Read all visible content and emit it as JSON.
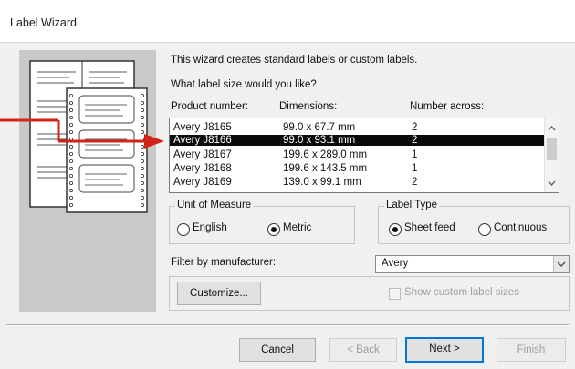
{
  "window": {
    "title": "Label Wizard"
  },
  "intro": {
    "line1": "This wizard creates standard labels or custom labels.",
    "line2": "What label size would you like?"
  },
  "table": {
    "headers": [
      "Product number:",
      "Dimensions:",
      "Number across:"
    ],
    "rows": [
      {
        "product": "Avery J8165",
        "dims": "99.0 x 67.7 mm",
        "across": "2"
      },
      {
        "product": "Avery J8166",
        "dims": "99.0 x 93.1 mm",
        "across": "2"
      },
      {
        "product": "Avery J8167",
        "dims": "199.6 x 289.0 mm",
        "across": "1"
      },
      {
        "product": "Avery J8168",
        "dims": "199.6 x 143.5 mm",
        "across": "1"
      },
      {
        "product": "Avery J8169",
        "dims": "139.0 x 99.1 mm",
        "across": "2"
      }
    ],
    "selected_product": "Avery J8166"
  },
  "unit_of_measure": {
    "label": "Unit of Measure",
    "options": [
      "English",
      "Metric"
    ],
    "selected": "Metric"
  },
  "label_type": {
    "label": "Label Type",
    "options": [
      "Sheet feed",
      "Continuous"
    ],
    "selected": "Sheet feed"
  },
  "filter": {
    "label": "Filter by manufacturer:",
    "value": "Avery"
  },
  "customize_label": "Customize...",
  "show_custom": {
    "label": "Show custom label sizes",
    "checked": false,
    "enabled": false
  },
  "buttons": {
    "cancel": "Cancel",
    "back": "< Back",
    "next": "Next >",
    "finish": "Finish"
  },
  "colors": {
    "selection": "#0a0a0a",
    "arrow": "#d32218",
    "default_button_border": "#0078d7",
    "illustration_bg": "#c9c9c9"
  },
  "icons": [
    "label-sheet-icon",
    "arrow-pointer-icon",
    "scroll-up-icon",
    "scroll-down-icon",
    "dropdown-chevron-icon"
  ]
}
